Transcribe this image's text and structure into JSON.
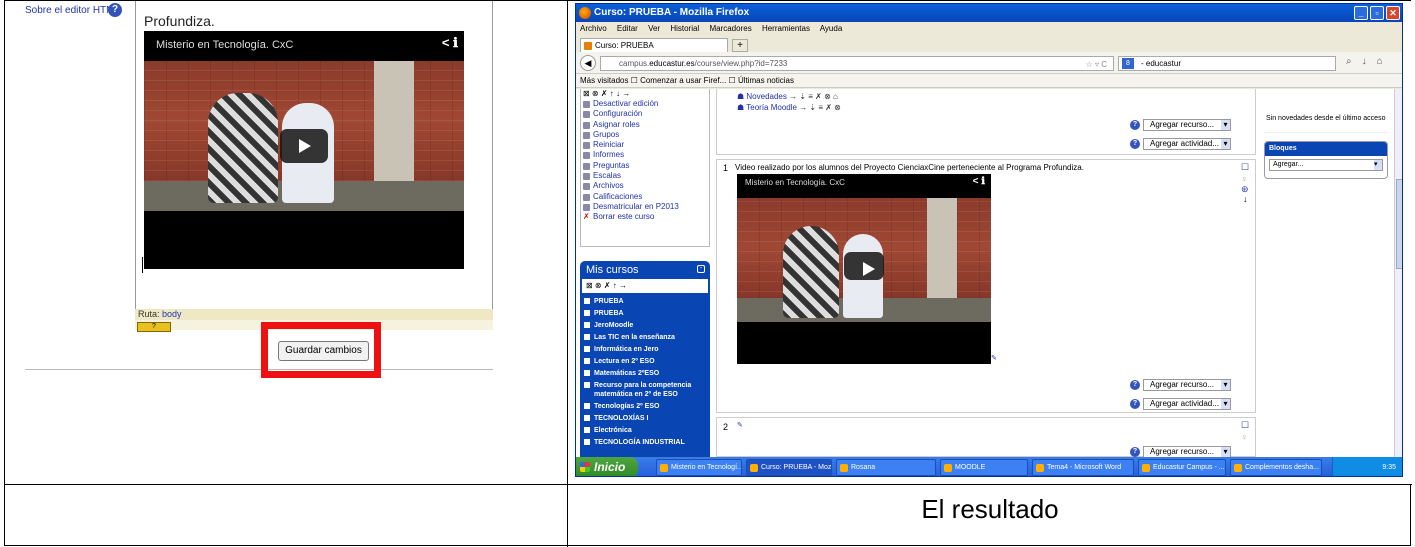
{
  "left_panel": {
    "sobre_label": "Sobre el editor HTML",
    "editor_text": "Profundiza.",
    "video_title": "Misterio en Tecnología. CxC",
    "video_icons": "< ℹ",
    "ruta_label": "Ruta:",
    "ruta_value": "body",
    "save_button": "Guardar cambios"
  },
  "firefox": {
    "window_title": "Curso: PRUEBA - Mozilla Firefox",
    "menu": [
      "Archivo",
      "Editar",
      "Ver",
      "Historial",
      "Marcadores",
      "Herramientas",
      "Ayuda"
    ],
    "tab_label": "Curso: PRUEBA",
    "new_tab": "+",
    "url_prefix": "campus.",
    "url_host": "educastur.es",
    "url_path": "/course/view.php?id=7233",
    "url_right": "☆ ▿ C",
    "search_engine": "8",
    "search_text": "- educastur",
    "bookmarks": "Más visitados  ☐ Comenzar a usar Firef...  ☐ Últimas noticias"
  },
  "admin": {
    "toolbar": "⊠ ⊗ ✗ ↑ ↓ →",
    "items": [
      "Desactivar edición",
      "Configuración",
      "Asignar roles",
      "Grupos",
      "Reiniciar",
      "Informes",
      "Preguntas",
      "Escalas",
      "Archivos",
      "Calificaciones",
      "Desmatricular en P2013",
      "Borrar este curso"
    ]
  },
  "mis_cursos": {
    "title": "Mis cursos",
    "toolbar": "⊠ ⊗ ✗ ↑ →",
    "courses": [
      "PRUEBA",
      "PRUEBA",
      "JeroMoodle",
      "Las TIC en la enseñanza",
      "Informática en Jero",
      "Lectura en 2º ESO",
      "Matemáticas 2ºESO",
      "Recurso para la competencia matemática en 2º de ESO",
      "Tecnologías 2º ESO",
      "TECNOLOXÍAS I",
      "Electrónica",
      "TECNOLOGÍA INDUSTRIAL"
    ]
  },
  "section0": {
    "novedades": "Novedades",
    "novedades_icons": "→ ⇣ ≡ ✗ ⊗ ⌂",
    "teoria": "Teoría Moodle",
    "teoria_icons": "→ ⇣ ≡ ✗ ⊗",
    "add_resource": "Agregar recurso...",
    "add_activity": "Agregar actividad..."
  },
  "section1": {
    "number": "1",
    "description": "Video realizado por los alumnos del Proyecto CienciaxCine perteneciente al Programa Profundiza.",
    "video_title": "Misterio en Tecnología. CxC",
    "video_icons": "< ℹ",
    "add_resource": "Agregar recurso...",
    "add_activity": "Agregar actividad..."
  },
  "section2": {
    "number": "2",
    "add_resource": "Agregar recurso..."
  },
  "right_blocks": {
    "novedades_text": "Sin novedades desde el último acceso",
    "bloques_title": "Bloques",
    "bloques_select": "Agregar..."
  },
  "taskbar": {
    "start": "Inicio",
    "items": [
      "Misterio en Tecnologí...",
      "Curso: PRUEBA - Moz...",
      "Rosana",
      "MOODLE",
      "Tema4 - Microsoft Word",
      "Educastur Campus - ...",
      "Complementos desha..."
    ],
    "clock": "9:35"
  },
  "caption": "El resultado"
}
